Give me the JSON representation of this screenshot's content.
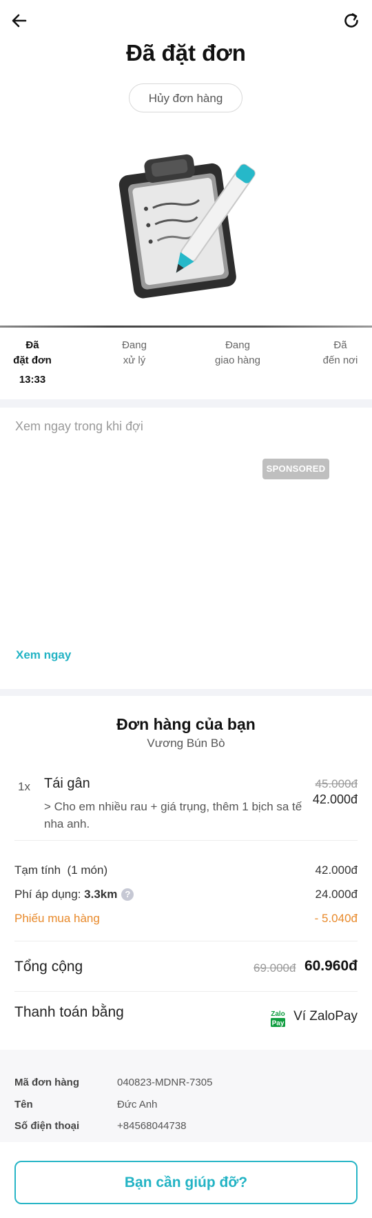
{
  "header": {
    "back_icon": "arrow-left-icon",
    "refresh_icon": "refresh-icon",
    "title": "Đã đặt đơn",
    "cancel_label": "Hủy đơn hàng"
  },
  "progress": {
    "steps": [
      {
        "line1": "Đã",
        "line2": "đặt đơn",
        "time": "13:33",
        "active": true
      },
      {
        "line1": "Đang",
        "line2": "xử lý",
        "active": false
      },
      {
        "line1": "Đang",
        "line2": "giao hàng",
        "active": false
      },
      {
        "line1": "Đã",
        "line2": "đến nơi",
        "active": false
      }
    ]
  },
  "ad": {
    "title": "Xem ngay trong khi đợi",
    "badge": "SPONSORED",
    "link": "Xem ngay"
  },
  "order": {
    "title": "Đơn hàng của bạn",
    "store": "Vương Bún Bò",
    "items": [
      {
        "qty": "1x",
        "name": "Tái gân",
        "note": "> Cho em nhiều rau + giá trụng, thêm 1 bịch sa tế nha anh.",
        "original_price": "45.000đ",
        "price": "42.000đ"
      }
    ],
    "subtotal": {
      "label": "Tạm tính",
      "count": "(1 món)",
      "value": "42.000đ"
    },
    "fee": {
      "label": "Phí áp dụng:",
      "distance": "3.3km",
      "help": "?",
      "value": "24.000đ"
    },
    "coupon": {
      "label": "Phiếu mua hàng",
      "value": "- 5.040đ"
    },
    "total": {
      "label": "Tổng cộng",
      "original": "69.000đ",
      "value": "60.960đ"
    },
    "payment": {
      "label": "Thanh toán bằng",
      "logo_top": "Zalo",
      "logo_bottom": "Pay",
      "method": "Ví ZaloPay"
    }
  },
  "meta": {
    "order_id": {
      "label": "Mã đơn hàng",
      "value": "040823-MDNR-7305"
    },
    "name": {
      "label": "Tên",
      "value": "Đức Anh"
    },
    "phone": {
      "label": "Số điện thoại",
      "value": "+84568044738"
    }
  },
  "help_button": "Bạn cần giúp đỡ?",
  "colors": {
    "accent": "#22b3c4",
    "coupon": "#e8892a",
    "zalo_green": "#0f9d3f",
    "zalo_blue": "#0068ff"
  }
}
